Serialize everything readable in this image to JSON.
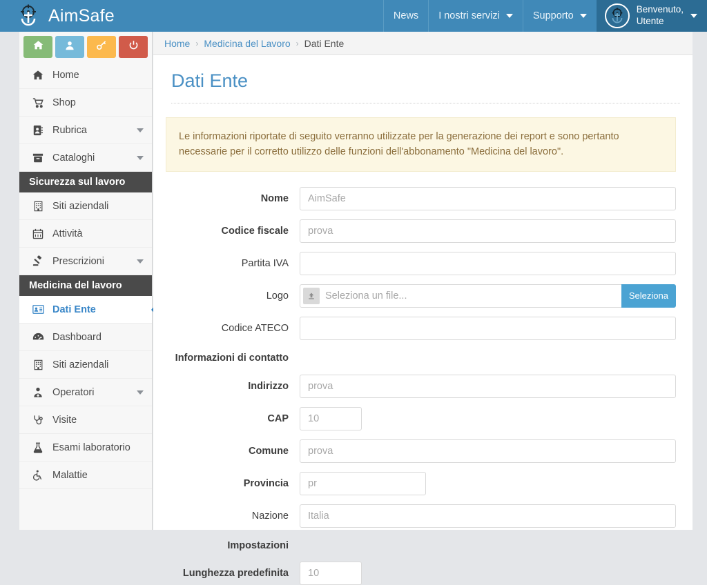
{
  "header": {
    "brand": "AimSafe",
    "brand_logo_icon": "crosshair-anchor-logo",
    "nav": [
      {
        "label": "News",
        "has_caret": false,
        "icon": ""
      },
      {
        "label": "I nostri servizi",
        "has_caret": true,
        "icon": "chevron-down-icon"
      },
      {
        "label": "Supporto",
        "has_caret": true,
        "icon": "chevron-down-icon"
      }
    ],
    "user": {
      "greeting": "Benvenuto,",
      "name": "Utente",
      "avatar_icon": "crosshair-anchor-avatar",
      "caret_icon": "chevron-down-icon"
    }
  },
  "sidebar": {
    "quick_actions": [
      {
        "name": "home",
        "icon": "home-icon",
        "color": "#86bb77"
      },
      {
        "name": "profile",
        "icon": "user-icon",
        "color": "#76bada"
      },
      {
        "name": "password",
        "icon": "key-icon",
        "color": "#fcb94d"
      },
      {
        "name": "logout",
        "icon": "power-icon",
        "color": "#d15b4a"
      }
    ],
    "items": [
      {
        "type": "item",
        "label": "Home",
        "icon": "home-icon",
        "chevron": false,
        "active": false
      },
      {
        "type": "item",
        "label": "Shop",
        "icon": "cart-icon",
        "chevron": false,
        "active": false
      },
      {
        "type": "item",
        "label": "Rubrica",
        "icon": "address-book-icon",
        "chevron": true,
        "active": false
      },
      {
        "type": "item",
        "label": "Cataloghi",
        "icon": "archive-icon",
        "chevron": true,
        "active": false
      },
      {
        "type": "section",
        "label": "Sicurezza sul lavoro"
      },
      {
        "type": "item",
        "label": "Siti aziendali",
        "icon": "building-icon",
        "chevron": false,
        "active": false
      },
      {
        "type": "item",
        "label": "Attività",
        "icon": "calendar-icon",
        "chevron": false,
        "active": false
      },
      {
        "type": "item",
        "label": "Prescrizioni",
        "icon": "gavel-icon",
        "chevron": true,
        "active": false
      },
      {
        "type": "section",
        "label": "Medicina del lavoro"
      },
      {
        "type": "item",
        "label": "Dati Ente",
        "icon": "id-card-icon",
        "chevron": false,
        "active": true
      },
      {
        "type": "item",
        "label": "Dashboard",
        "icon": "dashboard-icon",
        "chevron": false,
        "active": false
      },
      {
        "type": "item",
        "label": "Siti aziendali",
        "icon": "building-icon",
        "chevron": false,
        "active": false
      },
      {
        "type": "item",
        "label": "Operatori",
        "icon": "doctor-icon",
        "chevron": true,
        "active": false
      },
      {
        "type": "item",
        "label": "Visite",
        "icon": "stethoscope-icon",
        "chevron": false,
        "active": false
      },
      {
        "type": "item",
        "label": "Esami laboratorio",
        "icon": "flask-icon",
        "chevron": false,
        "active": false
      },
      {
        "type": "item",
        "label": "Malattie",
        "icon": "wheelchair-icon",
        "chevron": false,
        "active": false
      }
    ]
  },
  "breadcrumb": {
    "items": [
      "Home",
      "Medicina del Lavoro",
      "Dati Ente"
    ],
    "separator": "›"
  },
  "main": {
    "title": "Dati Ente",
    "alert": "Le informazioni riportate di seguito verranno utilizzate per la generazione dei report e sono pertanto necessarie per il corretto utilizzo delle funzioni dell'abbonamento \"Medicina del lavoro\".",
    "form": [
      {
        "kind": "input",
        "label": "Nome",
        "required": true,
        "value": "",
        "placeholder": "AimSafe",
        "size": "full"
      },
      {
        "kind": "input",
        "label": "Codice fiscale",
        "required": true,
        "value": "",
        "placeholder": "prova",
        "size": "full"
      },
      {
        "kind": "input",
        "label": "Partita IVA",
        "required": false,
        "value": "",
        "placeholder": "",
        "size": "full"
      },
      {
        "kind": "file",
        "label": "Logo",
        "required": false,
        "placeholder": "Seleziona un file...",
        "button": "Seleziona",
        "upload_icon": "upload-icon"
      },
      {
        "kind": "input",
        "label": "Codice ATECO",
        "required": false,
        "value": "",
        "placeholder": "",
        "size": "full"
      },
      {
        "kind": "section",
        "label": "Informazioni di contatto"
      },
      {
        "kind": "input",
        "label": "Indirizzo",
        "required": true,
        "value": "",
        "placeholder": "prova",
        "size": "full"
      },
      {
        "kind": "input",
        "label": "CAP",
        "required": true,
        "value": "",
        "placeholder": "10",
        "size": "sm"
      },
      {
        "kind": "input",
        "label": "Comune",
        "required": true,
        "value": "",
        "placeholder": "prova",
        "size": "full"
      },
      {
        "kind": "input",
        "label": "Provincia",
        "required": true,
        "value": "",
        "placeholder": "pr",
        "size": "md"
      },
      {
        "kind": "input",
        "label": "Nazione",
        "required": false,
        "value": "",
        "placeholder": "Italia",
        "size": "full"
      },
      {
        "kind": "section",
        "label": "Impostazioni"
      },
      {
        "kind": "input",
        "label": "Lunghezza predefinita",
        "required": true,
        "value": "",
        "placeholder": "10",
        "size": "sm"
      }
    ]
  },
  "colors": {
    "header_blue": "#4089b8",
    "user_blue": "#2c6c94",
    "accent_blue": "#4a90c4",
    "active_blue": "#3a87c8",
    "pointer_blue": "#2f80c0",
    "alert_bg": "#fcf7e3",
    "alert_text": "#8a6d3b",
    "section_gray": "#4a4a4a",
    "page_bg": "#e4e6e9"
  }
}
